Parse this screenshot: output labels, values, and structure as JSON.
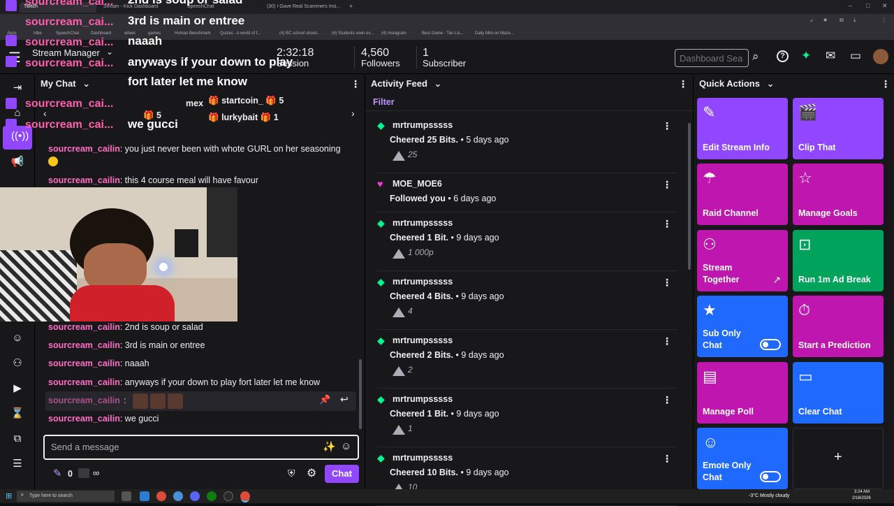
{
  "browser": {
    "tabs": [
      {
        "label": "Twitch",
        "active": true
      },
      {
        "label": "Stream - Kick Dashboard",
        "active": false
      },
      {
        "label": "SpeechChat",
        "active": false
      },
      {
        "label": "(30) I Gave Real Scammers Insi...",
        "active": false
      }
    ],
    "bookmarks": [
      "Apps",
      "tribe",
      "SpeechChat",
      "Dashboard",
      "wheel",
      "games",
      "Human Benchmark",
      "Quizes - A world of f...",
      "(4) BC school shooti...",
      "(4) Students seen ex...",
      "(4) Instagram",
      "Best Game - Tier Lis...",
      "Daily Mini on Maze..."
    ]
  },
  "topnav": {
    "app_title": "Stream Manager",
    "session_label": "Session",
    "stats": [
      {
        "value": "2:32:18",
        "label": "Session"
      },
      {
        "value": "4,560",
        "label": "Followers"
      },
      {
        "value": "1",
        "label": "Subscriber"
      }
    ],
    "search_placeholder": "Dashboard Sea"
  },
  "chat": {
    "header": "My Chat",
    "leaders": [
      {
        "name": "startcoin_",
        "count": "5"
      },
      {
        "name": "lurkybait",
        "count": "1"
      },
      {
        "name": "mex",
        "count": ""
      },
      {
        "name": "",
        "count": "5"
      }
    ],
    "messages_top": [
      {
        "user": "sourcream_cailin",
        "text": "you just never been with whote GURL on her seasoning"
      },
      {
        "user": "sourcream_cailin",
        "text": "this 4 course meal will have favour"
      }
    ],
    "messages": [
      {
        "user": "sourcream_cailin",
        "text": "2nd is soup or salad"
      },
      {
        "user": "sourcream_cailin",
        "text": "3rd is main or entree"
      },
      {
        "user": "sourcream_cailin",
        "text": "naaah"
      },
      {
        "user": "sourcream_cailin",
        "text": "anyways if your down to play fort later let me know"
      },
      {
        "user": "sourcream_cailin",
        "text": ""
      },
      {
        "user": "sourcream_cailin",
        "text": "we gucci"
      }
    ],
    "input_placeholder": "Send a message",
    "points": "0",
    "chat_button": "Chat"
  },
  "overlay": {
    "lines": [
      {
        "user": "sourcream_cai...",
        "text": "2nd is soup or salad"
      },
      {
        "user": "sourcream_cai...",
        "text": "3rd is main or entree"
      },
      {
        "user": "sourcream_cai...",
        "text": "naaah"
      },
      {
        "user": "sourcream_cai...",
        "text": "anyways if your down to play"
      },
      {
        "user": "",
        "text": "fort later let me know"
      },
      {
        "user": "sourcream_cai...",
        "text": ""
      },
      {
        "user": "sourcream_cai...",
        "text": "we gucci"
      }
    ]
  },
  "activity": {
    "header": "Activity Feed",
    "filter": "Filter",
    "items": [
      {
        "name": "mrtrumpsssss",
        "action": "Cheered",
        "amount": "25 Bits.",
        "time": "5 days ago",
        "bits": "25",
        "type": "cheer"
      },
      {
        "name": "MOE_MOE6",
        "action": "Followed",
        "amount": "you",
        "time": "6 days ago",
        "bits": "",
        "type": "follow"
      },
      {
        "name": "mrtrumpsssss",
        "action": "Cheered",
        "amount": "1 Bit.",
        "time": "9 days ago",
        "bits": "1 000p",
        "type": "cheer"
      },
      {
        "name": "mrtrumpsssss",
        "action": "Cheered",
        "amount": "4 Bits.",
        "time": "9 days ago",
        "bits": "4",
        "type": "cheer"
      },
      {
        "name": "mrtrumpsssss",
        "action": "Cheered",
        "amount": "2 Bits.",
        "time": "9 days ago",
        "bits": "2",
        "type": "cheer"
      },
      {
        "name": "mrtrumpsssss",
        "action": "Cheered",
        "amount": "1 Bit.",
        "time": "9 days ago",
        "bits": "1",
        "type": "cheer"
      },
      {
        "name": "mrtrumpsssss",
        "action": "Cheered",
        "amount": "10 Bits.",
        "time": "9 days ago",
        "bits": "10",
        "type": "cheer"
      }
    ]
  },
  "quick_actions": {
    "header": "Quick Actions",
    "tiles": [
      {
        "label": "Edit Stream Info",
        "color": "#9147ff"
      },
      {
        "label": "Clip That",
        "color": "#9147ff"
      },
      {
        "label": "Raid Channel",
        "color": "#c016b0"
      },
      {
        "label": "Manage Goals",
        "color": "#c016b0"
      },
      {
        "label": "Stream Together",
        "color": "#c016b0"
      },
      {
        "label": "Run 1m Ad Break",
        "color": "#00a35c"
      },
      {
        "label": "Sub Only Chat",
        "color": "#1f69ff"
      },
      {
        "label": "Start a Prediction",
        "color": "#c016b0"
      },
      {
        "label": "Manage Poll",
        "color": "#c016b0"
      },
      {
        "label": "Clear Chat",
        "color": "#1f69ff"
      },
      {
        "label": "Emote Only Chat",
        "color": "#1f69ff"
      },
      {
        "label": "+",
        "color": "#18181b"
      }
    ]
  },
  "taskbar": {
    "search": "Type here to search",
    "weather": "-3°C  Mostly cloudy",
    "time": "3:24 AM",
    "date": "2/16/2026"
  }
}
